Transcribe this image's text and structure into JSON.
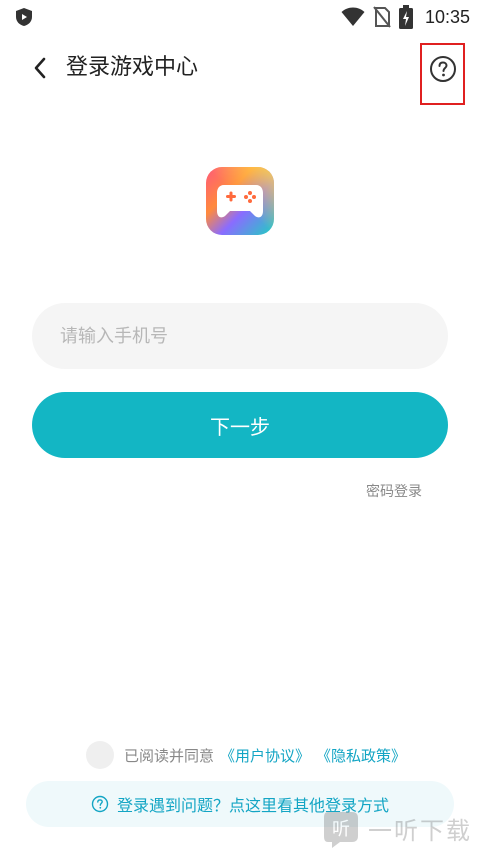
{
  "status_bar": {
    "time": "10:35",
    "icons": [
      "shield-play-icon",
      "wifi-icon",
      "no-sim-icon",
      "battery-charging-icon"
    ]
  },
  "header": {
    "title": "登录游戏中心",
    "back_icon": "chevron-left-icon",
    "help_icon": "question-circle-icon"
  },
  "app_logo": {
    "icon": "gamepad-icon"
  },
  "login_form": {
    "phone_placeholder": "请输入手机号",
    "phone_value": "",
    "next_label": "下一步",
    "password_login_label": "密码登录"
  },
  "agreement": {
    "text": "已阅读并同意",
    "user_agreement": "《用户协议》",
    "privacy_policy": "《隐私政策》",
    "checked": false
  },
  "help_banner": {
    "text": "登录遇到问题？点这里看其他登录方式"
  },
  "watermark": {
    "text": "一听下载"
  },
  "colors": {
    "accent": "#13b6c4",
    "link": "#13a5c4",
    "highlight_box": "#e02020",
    "input_bg": "#f5f5f5"
  }
}
